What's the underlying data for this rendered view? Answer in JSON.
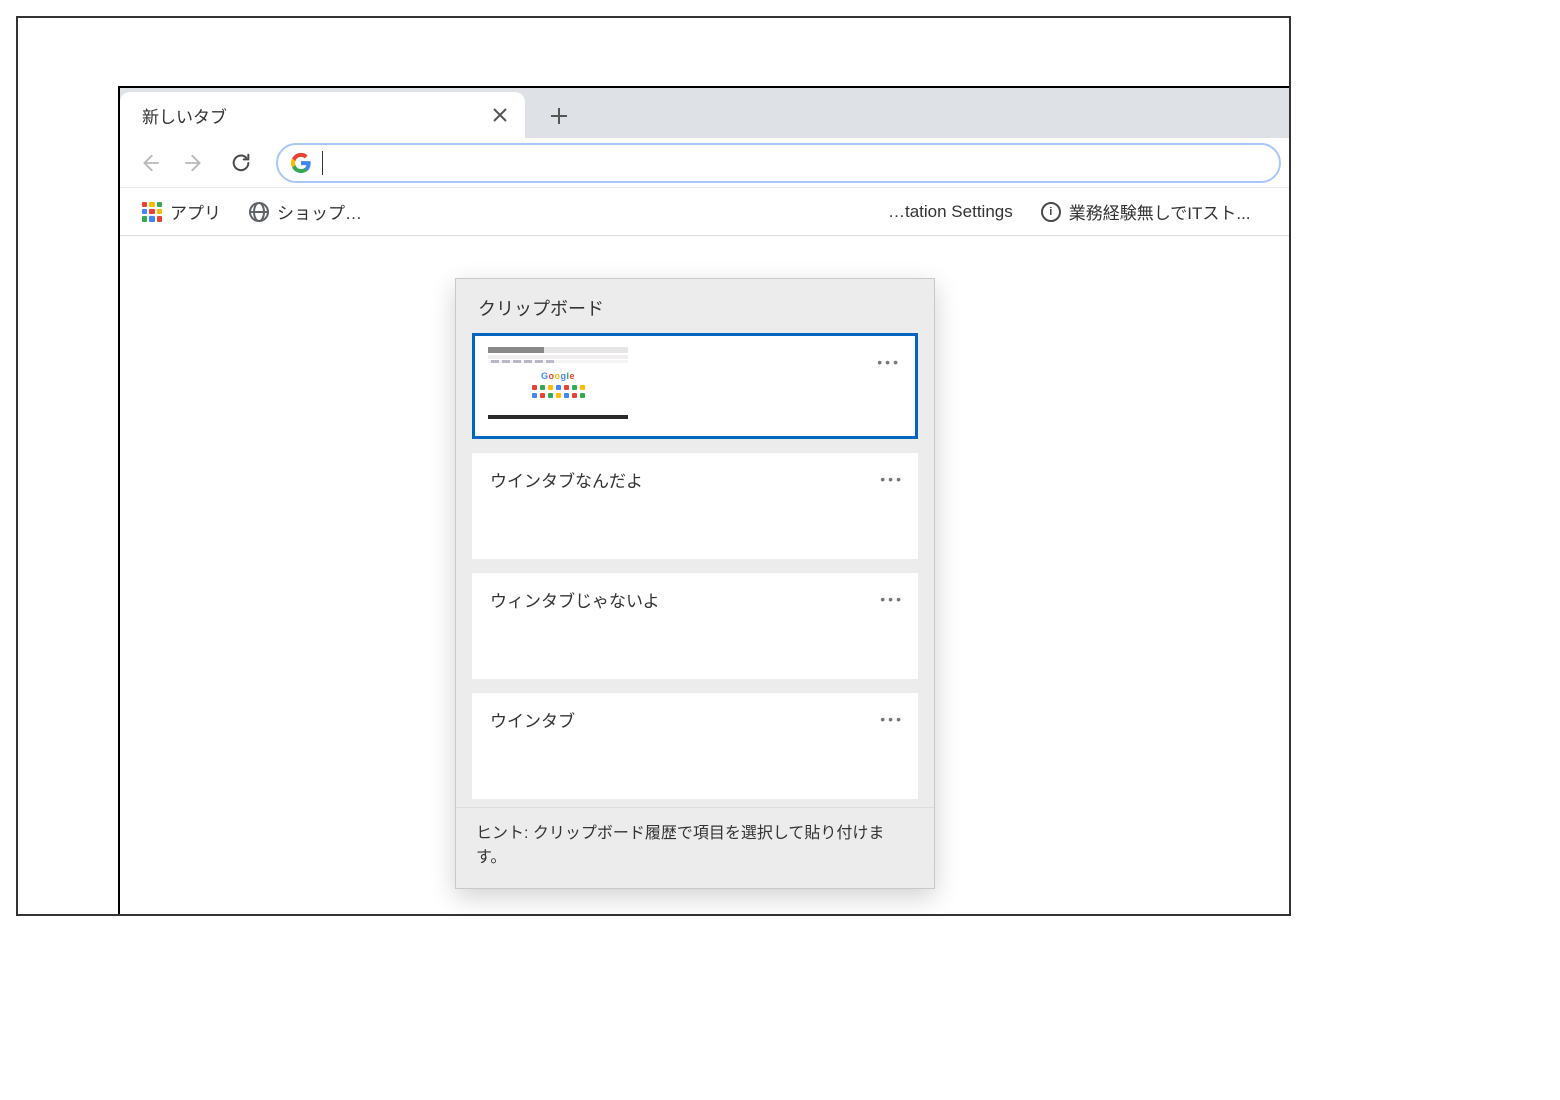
{
  "tab": {
    "title": "新しいタブ"
  },
  "toolbar": {
    "address_value": ""
  },
  "bookmarks": {
    "apps_label": "アプリ",
    "shop_label": "ショップ…",
    "station_label": "…tation Settings",
    "it_label": "業務経験無しでITスト..."
  },
  "clipboard": {
    "title": "クリップボード",
    "items": [
      {
        "type": "image",
        "thumb_label": "Google"
      },
      {
        "text": "ウインタブなんだよ"
      },
      {
        "text": "ウィンタブじゃないよ"
      },
      {
        "text": "ウインタブ"
      }
    ],
    "hint": "ヒント: クリップボード履歴で項目を選択して貼り付けます。"
  }
}
